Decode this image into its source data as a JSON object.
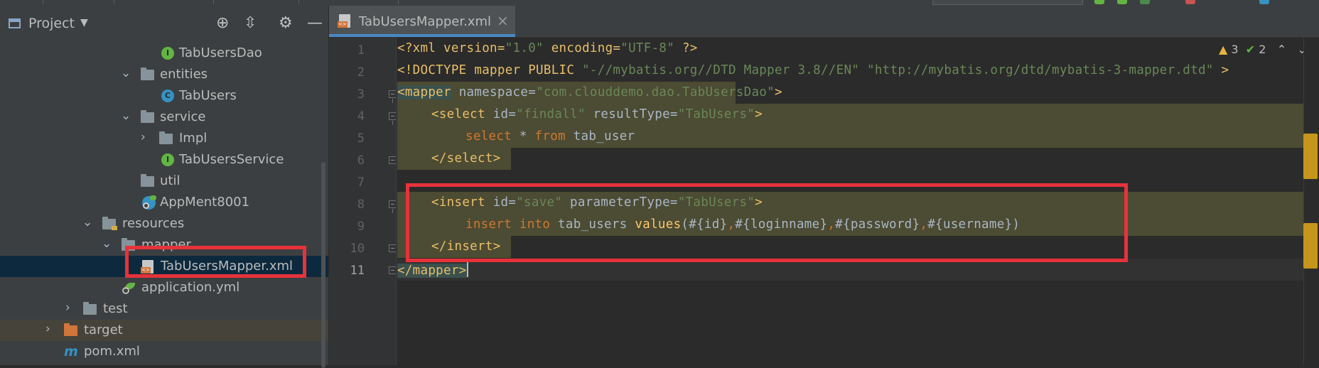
{
  "project_panel": {
    "title": "Project",
    "dropdown_icon": "caret-down-icon",
    "toolbar_icons": [
      "locate-icon",
      "collapse-all-icon",
      "gear-icon",
      "hide-icon"
    ],
    "tree": [
      {
        "label": "TabUsersDao",
        "icon": "interface-icon"
      },
      {
        "label": "entities",
        "icon": "folder-icon"
      },
      {
        "label": "TabUsers",
        "icon": "class-icon"
      },
      {
        "label": "service",
        "icon": "folder-icon"
      },
      {
        "label": "Impl",
        "icon": "folder-icon"
      },
      {
        "label": "TabUsersService",
        "icon": "interface-icon"
      },
      {
        "label": "util",
        "icon": "folder-icon"
      },
      {
        "label": "AppMent8001",
        "icon": "spring-boot-app-icon"
      },
      {
        "label": "resources",
        "icon": "resources-folder-icon"
      },
      {
        "label": "mapper",
        "icon": "folder-icon"
      },
      {
        "label": "TabUsersMapper.xml",
        "icon": "xml-file-icon"
      },
      {
        "label": "application.yml",
        "icon": "yml-file-icon"
      },
      {
        "label": "test",
        "icon": "folder-icon"
      },
      {
        "label": "target",
        "icon": "excluded-folder-icon"
      },
      {
        "label": "pom.xml",
        "icon": "maven-icon"
      }
    ]
  },
  "editor": {
    "tab_label": "TabUsersMapper.xml",
    "tab_close": "×",
    "inspections": {
      "warnings": "3",
      "checks": "2"
    },
    "line_numbers": [
      "1",
      "2",
      "3",
      "4",
      "5",
      "6",
      "7",
      "8",
      "9",
      "10",
      "11"
    ],
    "lines": {
      "l1": {
        "a": "<?xml version=",
        "b": "\"1.0\"",
        "c": " encoding=",
        "d": "\"UTF-8\"",
        "e": " ?>"
      },
      "l2": {
        "a": "<!DOCTYPE ",
        "b": "mapper PUBLIC ",
        "c": "\"-//mybatis.org//DTD Mapper 3.8//EN\"",
        "d": " ",
        "e": "\"http://mybatis.org/dtd/mybatis-3-mapper.dtd\"",
        "f": " >"
      },
      "l3": {
        "a": "<mapper",
        "b": " namespace=",
        "c": "\"com.clouddemo.dao.TabUsersDao\"",
        "d": ">"
      },
      "l4": {
        "a": "<select",
        "b": " id=",
        "c": "\"findall\"",
        "d": " resultType=",
        "e": "\"TabUsers\"",
        "f": ">"
      },
      "l5": {
        "a": "select",
        "b": " * ",
        "c": "from",
        "d": " tab_user"
      },
      "l6": {
        "a": "</select>"
      },
      "l8": {
        "a": "<insert",
        "b": " id=",
        "c": "\"save\"",
        "d": " parameterType=",
        "e": "\"TabUsers\"",
        "f": ">"
      },
      "l9": {
        "a": "insert",
        "b": " ",
        "c": "into",
        "d": " tab_users ",
        "e": "values",
        "f": "(#{id}",
        "g": ",",
        "h": "#{loginname}",
        "i": ",",
        "j": "#{password}",
        "k": ",",
        "l": "#{username})"
      },
      "l10": {
        "a": "</insert>"
      },
      "l11": {
        "a": "</mapper>"
      }
    }
  },
  "colors": {
    "highlight_box": "#e8323a",
    "xml_tag": "#e8bf6a",
    "string": "#6a8759",
    "keyword": "#cc7832",
    "selection_row": "#0d293e"
  }
}
